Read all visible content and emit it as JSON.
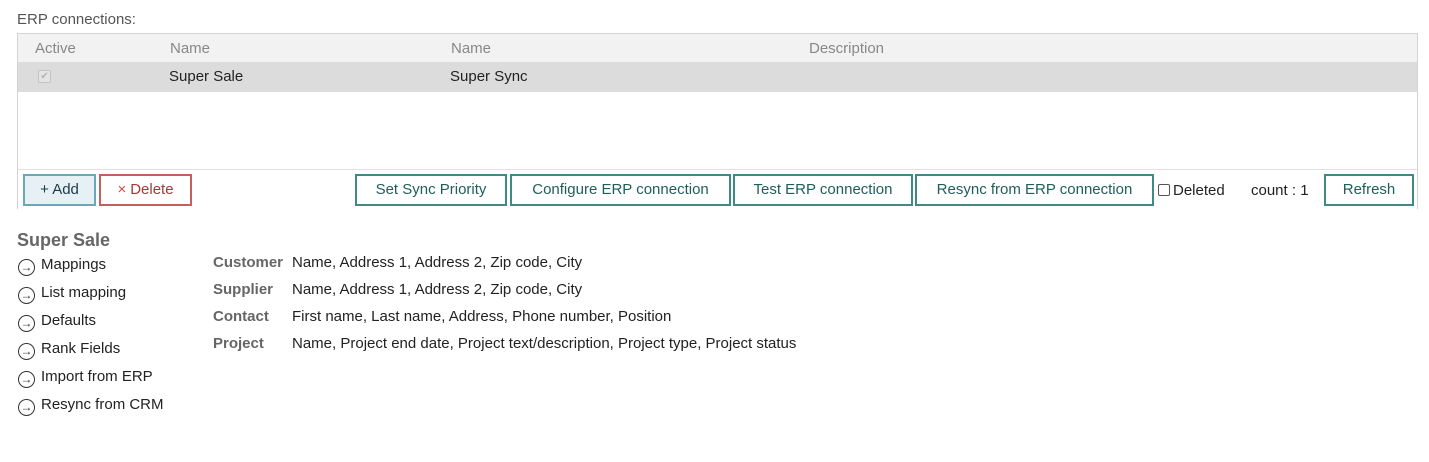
{
  "section_label": "ERP connections:",
  "grid": {
    "columns": [
      "Active",
      "Name",
      "Name",
      "Description"
    ],
    "rows": [
      {
        "active": "✔",
        "name1": "Super Sale",
        "name2": "Super Sync",
        "description": ""
      }
    ]
  },
  "toolbar": {
    "add_label": "+ Add",
    "delete_icon": "×",
    "delete_label": "Delete",
    "set_sync_priority": "Set Sync Priority",
    "configure": "Configure ERP connection",
    "test": "Test ERP connection",
    "resync": "Resync from ERP connection",
    "deleted_label": "Deleted",
    "count": "count : 1",
    "refresh": "Refresh"
  },
  "detail": {
    "title": "Super Sale",
    "arrow_icon": "→",
    "links": [
      "Mappings",
      "List mapping",
      "Defaults",
      "Rank Fields",
      "Import from ERP",
      "Resync from CRM"
    ],
    "mappings": [
      {
        "key": "Customer",
        "value": "Name, Address 1, Address 2, Zip code, City"
      },
      {
        "key": "Supplier",
        "value": "Name, Address 1, Address 2, Zip code, City"
      },
      {
        "key": "Contact",
        "value": "First name, Last name, Address, Phone number, Position"
      },
      {
        "key": "Project",
        "value": "Name, Project end date, Project text/description, Project type, Project status"
      }
    ]
  }
}
